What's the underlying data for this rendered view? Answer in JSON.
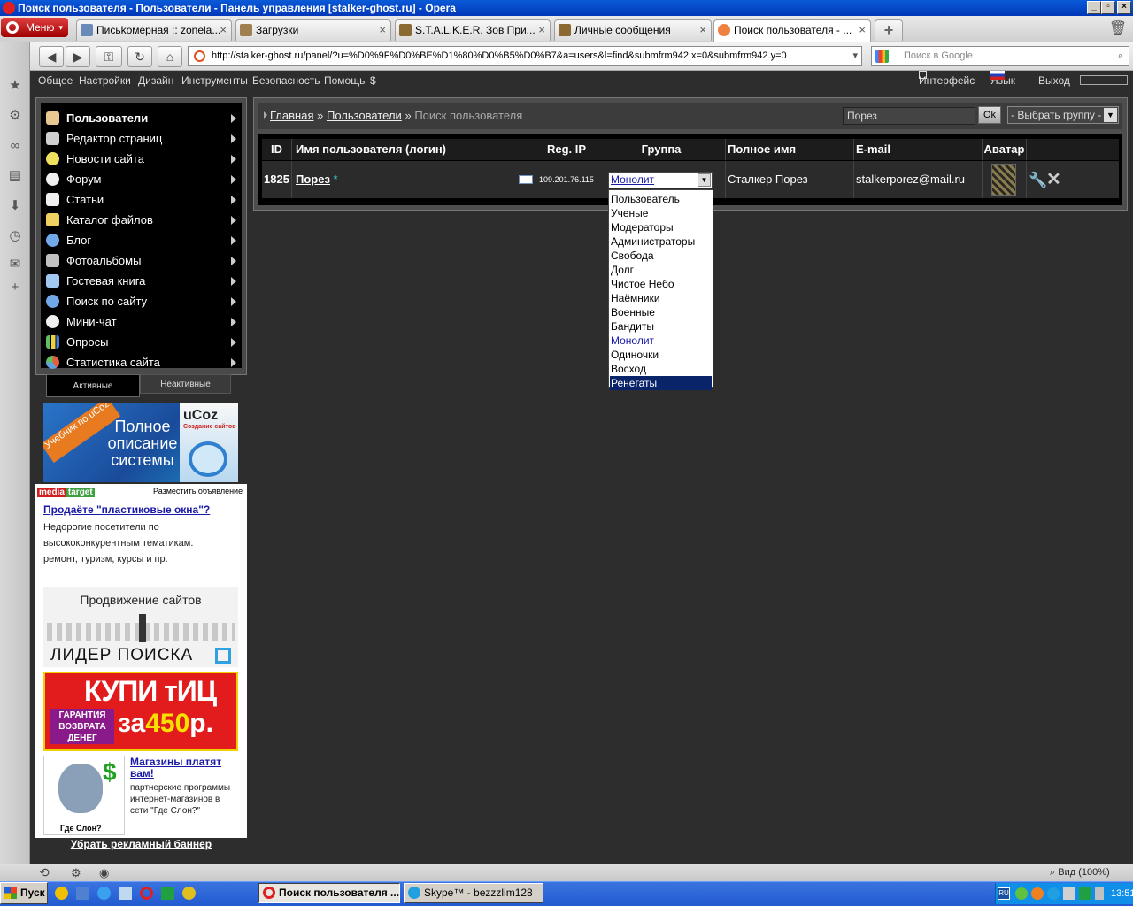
{
  "window": {
    "title": "Поиск пользователя - Пользователи - Панель управления [stalker-ghost.ru] - Opera"
  },
  "browser": {
    "menu_label": "Меню",
    "tabs": [
      {
        "label": "Письkомерная :: zonela..."
      },
      {
        "label": "Загрузки"
      },
      {
        "label": "S.T.A.L.K.E.R. Зов При..."
      },
      {
        "label": "Личные сообщения"
      },
      {
        "label": "Поиск пользователя - ..."
      }
    ],
    "url": "http://stalker-ghost.ru/panel/?u=%D0%9F%D0%BE%D1%80%D0%B5%D0%B7&a=users&l=find&submfrm942.x=0&submfrm942.y=0",
    "search_placeholder": "Поиск в Google",
    "zoom": "Вид (100%)"
  },
  "admin_menu": {
    "items": [
      "Общее",
      "Настройки",
      "Дизайн",
      "Инструменты",
      "Безопасность",
      "Помощь",
      "$"
    ],
    "right": {
      "interface": "Интерфейс",
      "language": "Язык",
      "logout": "Выход"
    }
  },
  "left_menu": {
    "items": [
      {
        "label": "Пользователи",
        "icon": "user-icon",
        "color": "#e8c890"
      },
      {
        "label": "Редактор страниц",
        "icon": "pencil-icon",
        "color": "#d0d0d0"
      },
      {
        "label": "Новости сайта",
        "icon": "bulb-icon",
        "color": "#f0e060"
      },
      {
        "label": "Форум",
        "icon": "speech-icon",
        "color": "#f0f0f0"
      },
      {
        "label": "Статьи",
        "icon": "article-icon",
        "color": "#f0f0f0"
      },
      {
        "label": "Каталог файлов",
        "icon": "folder-icon",
        "color": "#f0d060"
      },
      {
        "label": "Блог",
        "icon": "gear-icon",
        "color": "#70a8e8"
      },
      {
        "label": "Фотоальбомы",
        "icon": "camera-icon",
        "color": "#c0c0c0"
      },
      {
        "label": "Гостевая книга",
        "icon": "book-icon",
        "color": "#a0c8f0"
      },
      {
        "label": "Поиск по сайту",
        "icon": "magnifier-icon",
        "color": "#70a8e8"
      },
      {
        "label": "Мини-чат",
        "icon": "chat-icon",
        "color": "#f0f0f0"
      },
      {
        "label": "Опросы",
        "icon": "barchart-icon",
        "color": "#60c060"
      },
      {
        "label": "Статистика сайта",
        "icon": "piechart-icon",
        "color": "#e06040"
      }
    ],
    "tab_active": "Активные",
    "tab_inactive": "Неактивные"
  },
  "ads": {
    "ucoz": {
      "corner": "Учебник по uCoz",
      "line1": "Полное",
      "line2": "описание",
      "line3": "системы",
      "logo": "uCoz",
      "logo_sub": "Создание сайтов"
    },
    "mediatarget": {
      "logo_a": "media",
      "logo_b": "target",
      "place": "Разместить объявление",
      "headline": "Продаёте \"пластиковые окна\"?",
      "text": "Недорогие посетители по высококонкурентным тематикам: ремонт, туризм, курсы и пр."
    },
    "lider": {
      "title": "Продвижение сайтов",
      "brand": "ЛИДЕР ПОИСКА"
    },
    "tic": {
      "line1": "КУПИ тИЦ",
      "guarantee": "ГАРАНТИЯ ВОЗВРАТА ДЕНЕГ",
      "price_prefix": "за",
      "price": "450",
      "price_suffix": "р."
    },
    "slon": {
      "headline": "Магазины платят вам!",
      "text": "партнерские программы интернет-магазинов в сети \"Где Слон?\"",
      "caption": "Где Слон?"
    },
    "remove": "Убрать рекламный баннер"
  },
  "breadcrumb": {
    "home": "Главная",
    "sep": "»",
    "section": "Пользователи",
    "current": "Поиск пользователя"
  },
  "search": {
    "value": "Порез",
    "ok": "Ok",
    "group_select": "- Выбрать группу -"
  },
  "table": {
    "headers": [
      "ID",
      "Имя пользователя (логин)",
      "Reg. IP",
      "Группа",
      "Полное имя",
      "E-mail",
      "Аватар"
    ],
    "row": {
      "id": "1825",
      "login": "Порез",
      "star": "*",
      "ip": "109.201.76.115",
      "group": "Монолит",
      "full_name": "Сталкер Порез",
      "email": "stalkerporez@mail.ru"
    }
  },
  "group_options": [
    "Пользователь",
    "Ученые",
    "Модераторы",
    "Администраторы",
    "Свобода",
    "Долг",
    "Чистое Небо",
    "Наёмники",
    "Военные",
    "Бандиты",
    "Монолит",
    "Одиночки",
    "Восход",
    "Ренегаты"
  ],
  "group_selected_index": 10,
  "group_highlight_index": 13,
  "taskbar": {
    "start": "Пуск",
    "tasks": [
      "Поиск пользователя ...",
      "Skype™ - bezzzlim128"
    ],
    "lang": "RU",
    "clock": "13:51"
  }
}
